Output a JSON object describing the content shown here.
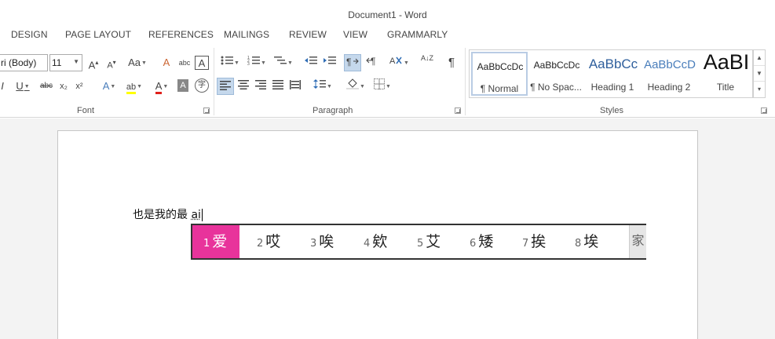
{
  "window": {
    "title": "Document1 - Word"
  },
  "tabs": [
    "DESIGN",
    "PAGE LAYOUT",
    "REFERENCES",
    "MAILINGS",
    "REVIEW",
    "VIEW",
    "GRAMMARLY"
  ],
  "font": {
    "name_value": "ri (Body)",
    "size_value": "11",
    "group_label": "Font",
    "grow_label": "A",
    "shrink_label": "A",
    "case_label": "Aa",
    "italic_label": "I",
    "underline_label": "U",
    "strike_label": "abc",
    "sub_label": "x₂",
    "sup_label": "x²",
    "effects_label": "A",
    "highlight_label": "ab",
    "color_label": "A",
    "shading_label": "A",
    "enclose_label": "字",
    "clear_label": "A",
    "phonetic_label": "abc",
    "border_char_label": "A"
  },
  "paragraph": {
    "group_label": "Paragraph",
    "sort_label": "A↓Z",
    "pilcrow_label": "¶"
  },
  "styles": {
    "group_label": "Styles",
    "items": [
      {
        "sample": "AaBbCcDc",
        "name": "¶ Normal"
      },
      {
        "sample": "AaBbCcDc",
        "name": "¶ No Spac..."
      },
      {
        "sample": "AaBbCc",
        "name": "Heading 1"
      },
      {
        "sample": "AaBbCcD",
        "name": "Heading 2"
      },
      {
        "sample": "AaBI",
        "name": "Title"
      }
    ]
  },
  "document": {
    "text": "也是我的最 ",
    "composition": "ai"
  },
  "ime": {
    "candidates": [
      {
        "num": "1",
        "char": "爱"
      },
      {
        "num": "2",
        "char": "哎"
      },
      {
        "num": "3",
        "char": "唉"
      },
      {
        "num": "4",
        "char": "欸"
      },
      {
        "num": "5",
        "char": "艾"
      },
      {
        "num": "6",
        "char": "矮"
      },
      {
        "num": "7",
        "char": "挨"
      },
      {
        "num": "8",
        "char": "埃"
      }
    ],
    "more_glyph": "家"
  },
  "colors": {
    "accent_candidate": "#e8339b",
    "highlight_yellow": "#ffff00",
    "font_red": "#e0201b"
  }
}
